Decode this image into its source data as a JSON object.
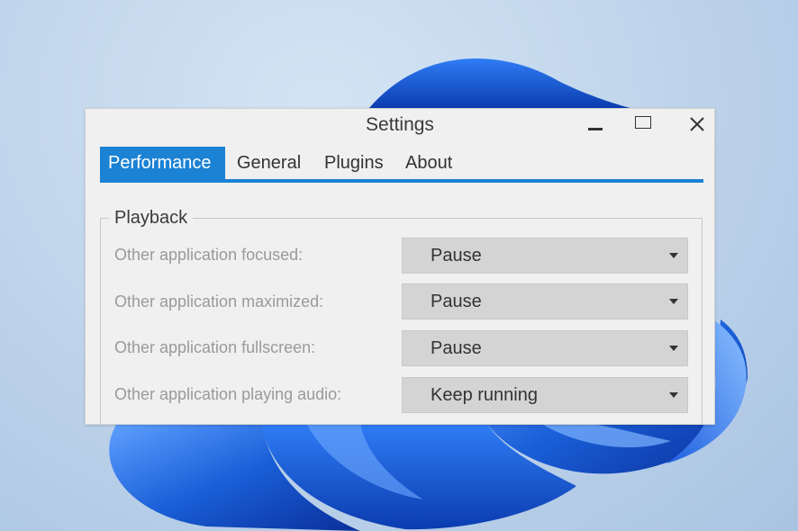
{
  "window": {
    "title": "Settings"
  },
  "tabs": [
    {
      "label": "Performance",
      "active": true
    },
    {
      "label": "General",
      "active": false
    },
    {
      "label": "Plugins",
      "active": false
    },
    {
      "label": "About",
      "active": false
    }
  ],
  "playback": {
    "legend": "Playback",
    "rows": [
      {
        "label": "Other application focused:",
        "value": "Pause"
      },
      {
        "label": "Other application maximized:",
        "value": "Pause"
      },
      {
        "label": "Other application fullscreen:",
        "value": "Pause"
      },
      {
        "label": "Other application playing audio:",
        "value": "Keep running"
      }
    ]
  },
  "colors": {
    "accent": "#1b82d4",
    "window_bg": "#f0f0f0",
    "dropdown_bg": "#d4d4d4",
    "wallpaper_bg": "#c2d6ec",
    "bloom": "#1a5fd8"
  },
  "icons": {
    "minimize": "minimize-icon",
    "maximize": "maximize-icon",
    "close": "close-icon",
    "dropdown": "chevron-down-icon"
  }
}
